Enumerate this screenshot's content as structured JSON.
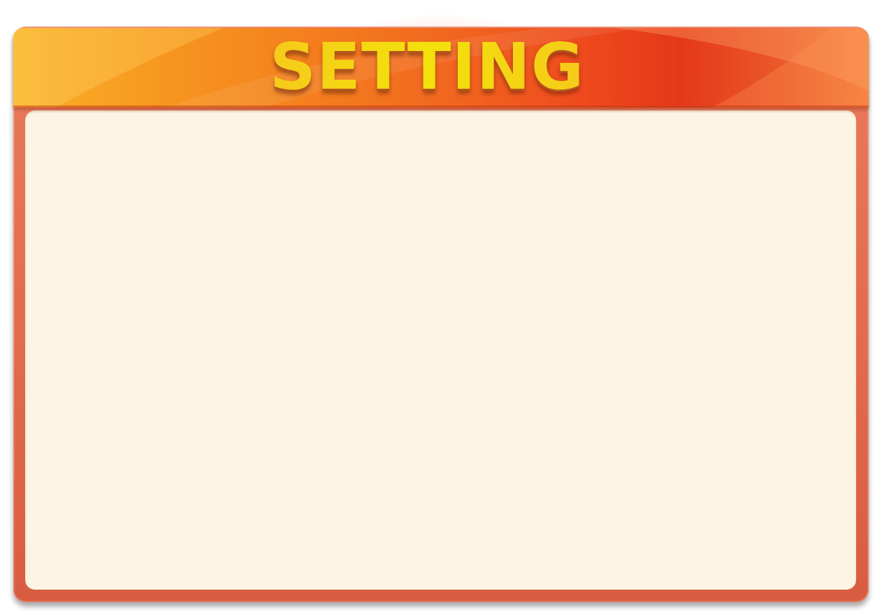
{
  "dialog": {
    "title": "SETTING"
  },
  "colors": {
    "frame": "#e2694c",
    "content_background": "#fdf5e4",
    "banner_start": "#fbb02a",
    "banner_end": "#e5381a",
    "title_fill": "#f3e10c"
  }
}
